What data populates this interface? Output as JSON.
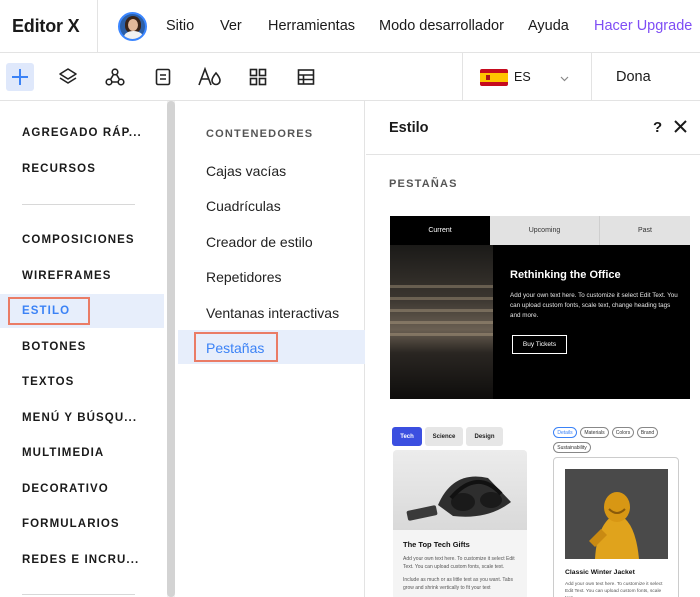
{
  "app": {
    "logo": "Editor X",
    "menu": [
      "Sitio",
      "Ver",
      "Herramientas",
      "Modo desarrollador",
      "Ayuda"
    ],
    "upgrade": "Hacer Upgrade"
  },
  "toolbar": {
    "tools": [
      "add-icon",
      "layers-icon",
      "connections-icon",
      "pages-icon",
      "theme-icon",
      "apps-icon",
      "cms-icon"
    ],
    "language_code": "ES",
    "site_name": "Dona"
  },
  "left_panel": {
    "categories": [
      "AGREGADO RÁP...",
      "RECURSOS",
      "COMPOSICIONES",
      "WIREFRAMES",
      "ESTILO",
      "BOTONES",
      "TEXTOS",
      "MENÚ Y BÚSQU...",
      "MULTIMEDIA",
      "DECORATIVO",
      "FORMULARIOS",
      "REDES E INCRU..."
    ],
    "active": "ESTILO"
  },
  "middle_panel": {
    "heading": "CONTENEDORES",
    "items": [
      "Cajas vacías",
      "Cuadrículas",
      "Creador de estilo",
      "Repetidores",
      "Ventanas interactivas",
      "Pestañas"
    ],
    "active": "Pestañas"
  },
  "right_panel": {
    "title": "Estilo",
    "help": "?",
    "section": "PESTAÑAS",
    "preview1": {
      "tabs": [
        "Current",
        "Upcoming",
        "Past"
      ],
      "title": "Rethinking the Office",
      "body": "Add your own text here. To customize it select Edit Text. You can upload custom fonts, scale text, change heading tags and more.",
      "button": "Buy Tickets"
    },
    "preview2": {
      "tabs": [
        "Tech",
        "Science",
        "Design"
      ],
      "title": "The Top Tech Gifts",
      "body1": "Add your own text here. To customize it select Edit Text. You can upload custom fonts, scale text.",
      "body2": "Include as much or as little text as you want. Tabs grow and shrink vertically to fit your text"
    },
    "preview3": {
      "pills": [
        "Details",
        "Materials",
        "Colors",
        "Brand",
        "Sustainability"
      ],
      "title": "Classic Winter Jacket",
      "body": "Add your own text here. To customize it select Edit Text. You can upload custom fonts, scale text."
    }
  },
  "colors": {
    "accent": "#3b82f6",
    "upgrade": "#7e4df5",
    "highlight_border": "#ea7c66",
    "active_bg": "#e7eefb"
  }
}
